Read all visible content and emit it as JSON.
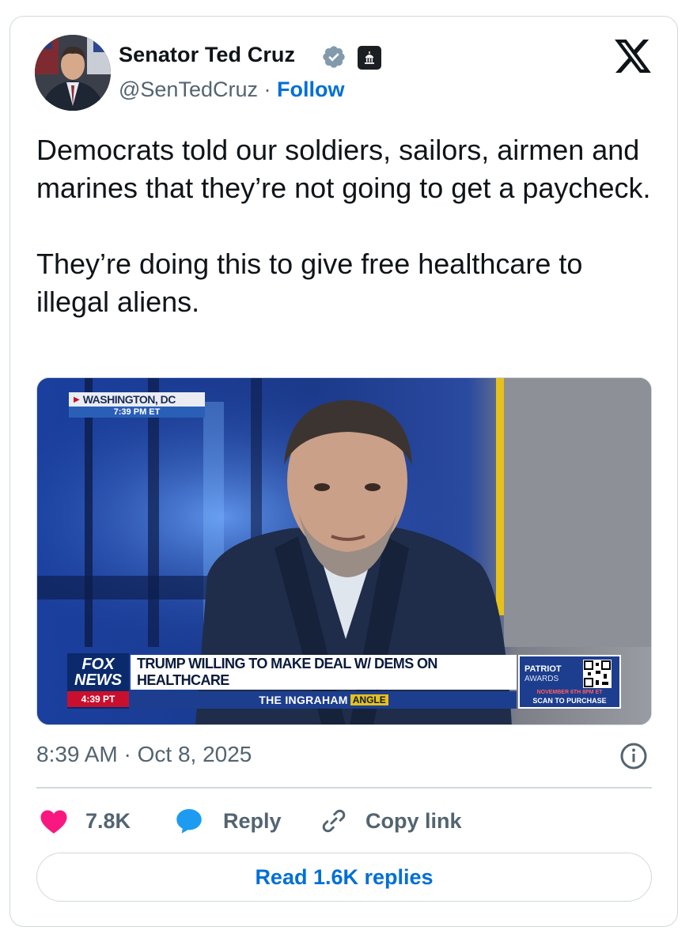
{
  "author": {
    "name": "Senator Ted Cruz",
    "handle": "@SenTedCruz",
    "separator": " · ",
    "follow_label": "Follow"
  },
  "tweet": {
    "text": "Democrats told our soldiers, sailors, airmen and marines that they’re not going to get a paycheck.\n\nThey’re doing this to give free healthcare to illegal aliens.",
    "timestamp": "8:39 AM · Oct 8, 2025"
  },
  "media": {
    "location": "WASHINGTON, DC",
    "location_time": "7:39 PM ET",
    "network_line1": "FOX",
    "network_line2": "NEWS",
    "network_time": "4:39 PT",
    "headline": "TRUMP WILLING TO MAKE DEAL W/ DEMS ON HEALTHCARE",
    "show_prefix": "THE INGRAHAM",
    "show_suffix": "ANGLE",
    "promo_line1": "PATRIOT",
    "promo_line2": "AWARDS",
    "promo_date": "NOVEMBER 6TH 8PM ET",
    "promo_cta": "SCAN TO PURCHASE"
  },
  "actions": {
    "likes": "7.8K",
    "reply_label": "Reply",
    "copy_link_label": "Copy link",
    "read_replies_label": "Read 1.6K replies"
  },
  "colors": {
    "link_blue": "#006fd6",
    "verified_blue": "#829aab",
    "like_pink": "#f91880",
    "reply_blue": "#1d9bf0",
    "fox_red": "#c8102e"
  },
  "icons": [
    "verified-badge-icon",
    "government-building-icon",
    "x-logo-icon",
    "info-icon",
    "heart-icon",
    "reply-bubble-icon",
    "link-icon"
  ]
}
